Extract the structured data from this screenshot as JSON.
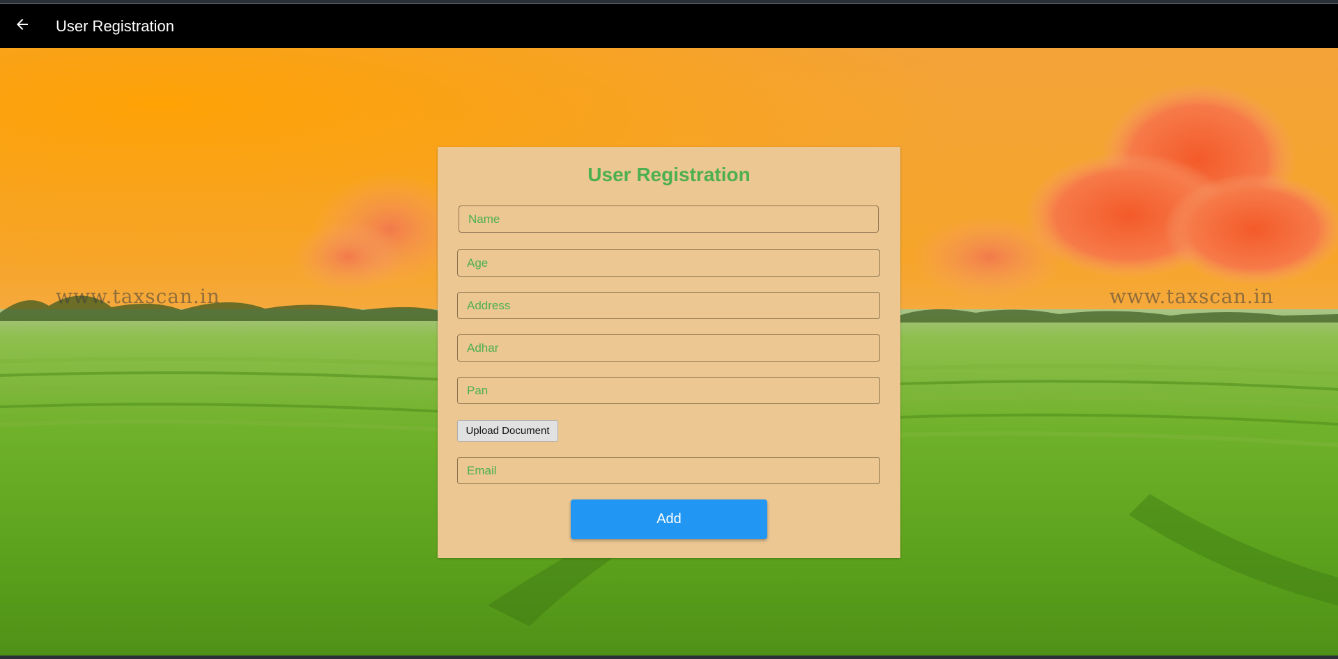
{
  "appbar": {
    "title": "User Registration",
    "back_icon": "arrow-left-icon"
  },
  "background": {
    "watermark_left": "www.taxscan.in",
    "watermark_right": "www.taxscan.in"
  },
  "form": {
    "title": "User Registration",
    "fields": [
      {
        "placeholder": "Name",
        "value": ""
      },
      {
        "placeholder": "Age",
        "value": ""
      },
      {
        "placeholder": "Address",
        "value": ""
      },
      {
        "placeholder": "Adhar",
        "value": ""
      },
      {
        "placeholder": "Pan",
        "value": ""
      },
      {
        "placeholder": "Email",
        "value": ""
      }
    ],
    "upload_label": "Upload Document",
    "submit_label": "Add"
  },
  "colors": {
    "appbar": "#000000",
    "card": "#ecc792",
    "accent_text": "#4caf50",
    "submit_button": "#2196f3"
  }
}
